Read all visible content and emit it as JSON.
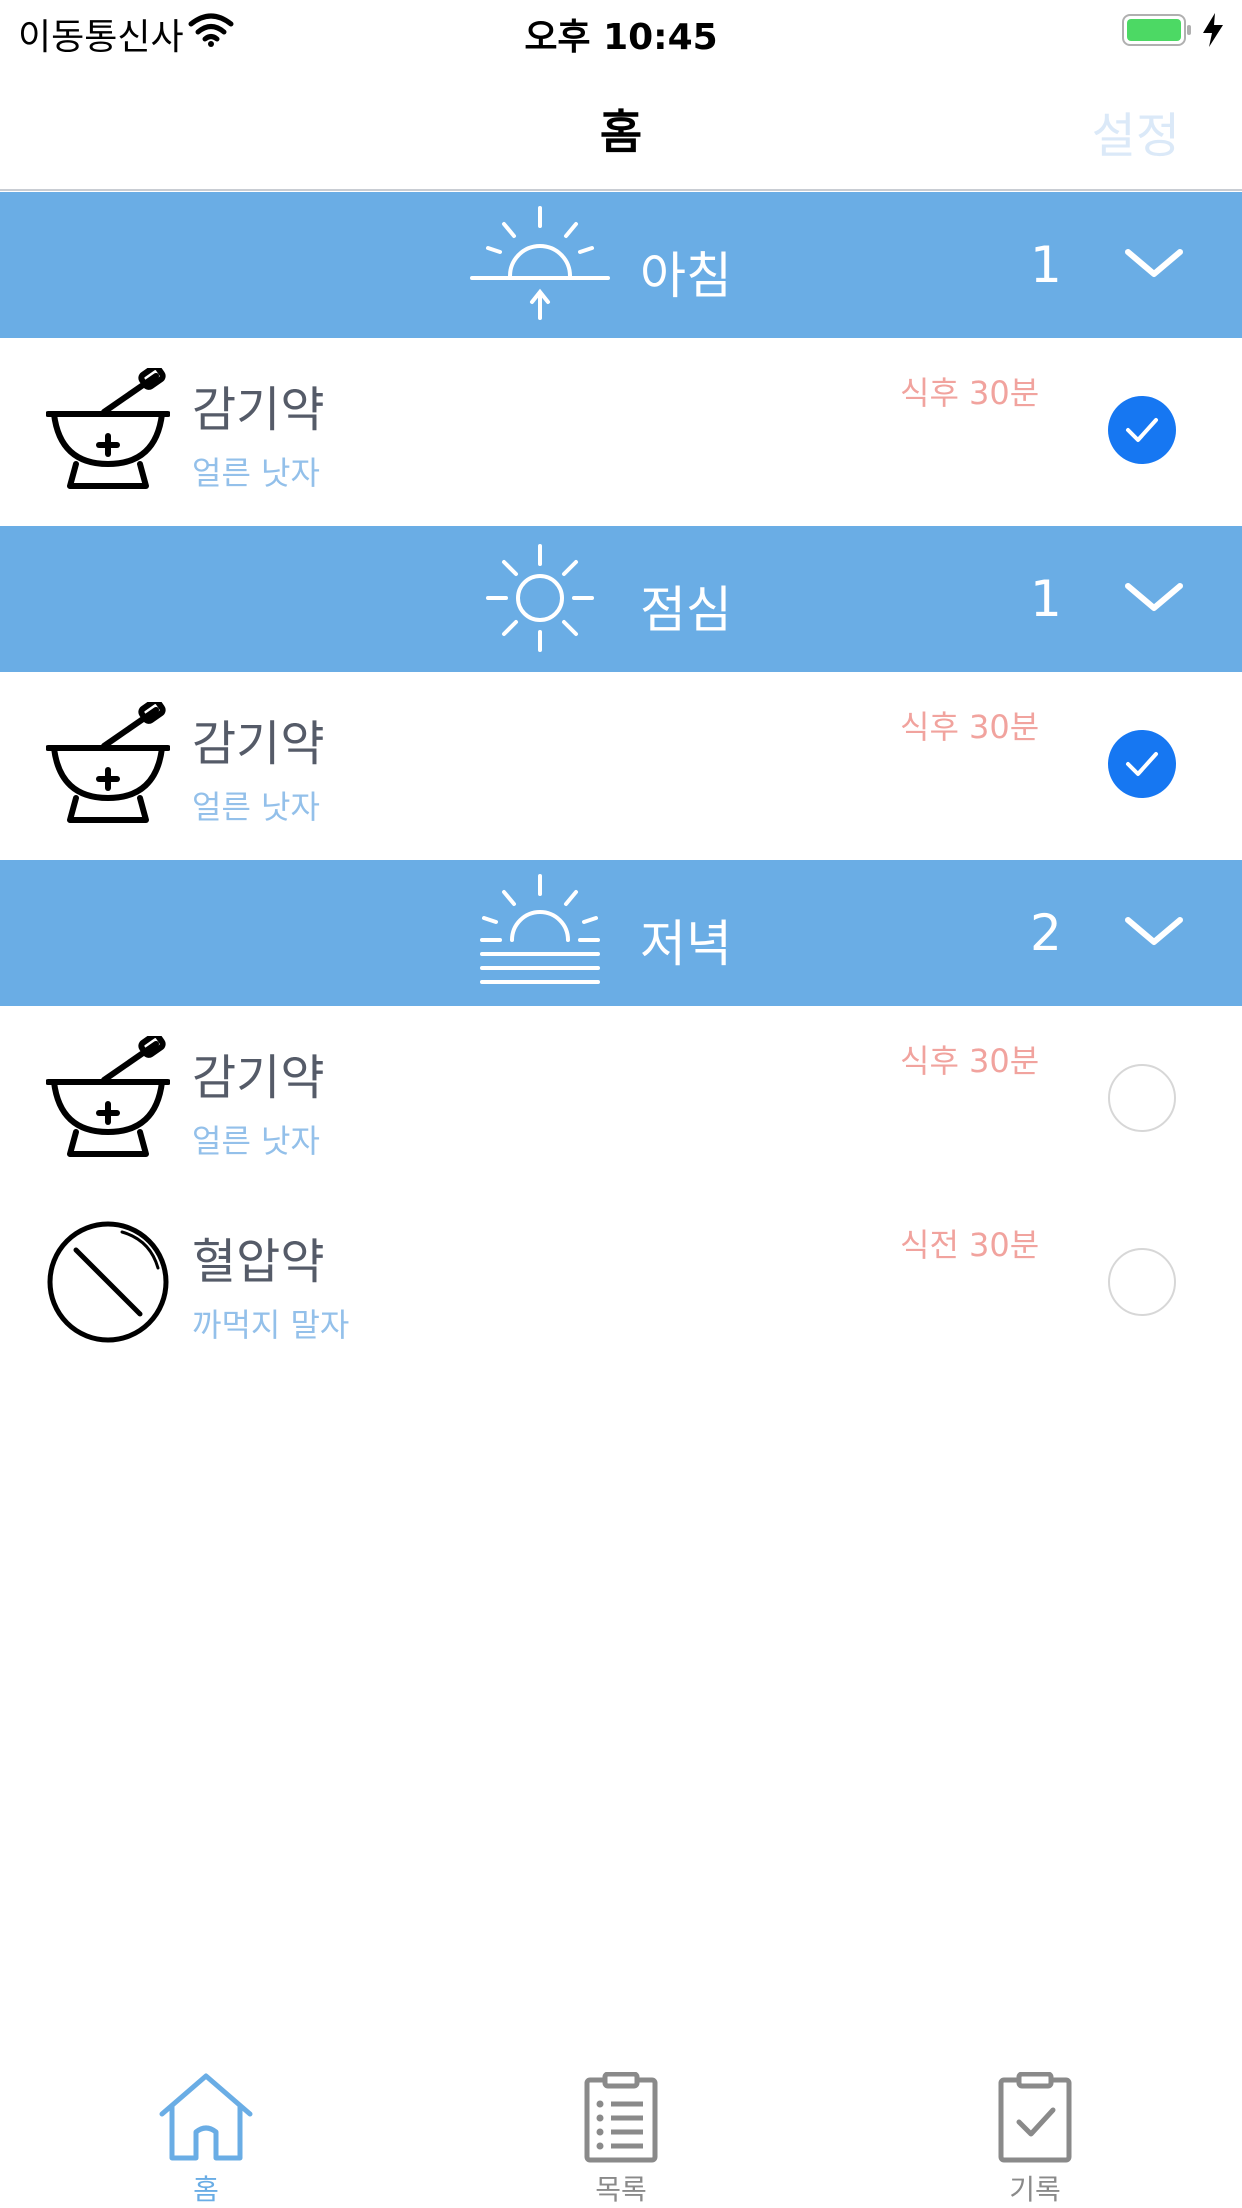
{
  "status_bar": {
    "carrier": "이동통신사",
    "time": "오후 10:45"
  },
  "nav": {
    "title": "홈",
    "settings_label": "설정"
  },
  "colors": {
    "section_bg": "#6aade5",
    "check_blue": "#1677f2",
    "time_red": "#f1a39e",
    "memo_blue": "#93c0ea"
  },
  "sections": [
    {
      "title": "아침",
      "count": "1",
      "icon": "sunrise-icon",
      "items": [
        {
          "name": "감기약",
          "memo": "얼른 낫자",
          "time": "식후 30분",
          "icon": "mortar-pestle-icon",
          "checked": true
        }
      ]
    },
    {
      "title": "점심",
      "count": "1",
      "icon": "sun-icon",
      "items": [
        {
          "name": "감기약",
          "memo": "얼른 낫자",
          "time": "식후 30분",
          "icon": "mortar-pestle-icon",
          "checked": true
        }
      ]
    },
    {
      "title": "저녁",
      "count": "2",
      "icon": "sunset-icon",
      "items": [
        {
          "name": "감기약",
          "memo": "얼른 낫자",
          "time": "식후 30분",
          "icon": "mortar-pestle-icon",
          "checked": false
        },
        {
          "name": "혈압약",
          "memo": "까먹지 말자",
          "time": "식전 30분",
          "icon": "pill-icon",
          "checked": false
        }
      ]
    }
  ],
  "tabs": [
    {
      "label": "홈",
      "icon": "home-icon",
      "active": true
    },
    {
      "label": "목록",
      "icon": "list-clipboard-icon",
      "active": false
    },
    {
      "label": "기록",
      "icon": "check-clipboard-icon",
      "active": false
    }
  ]
}
